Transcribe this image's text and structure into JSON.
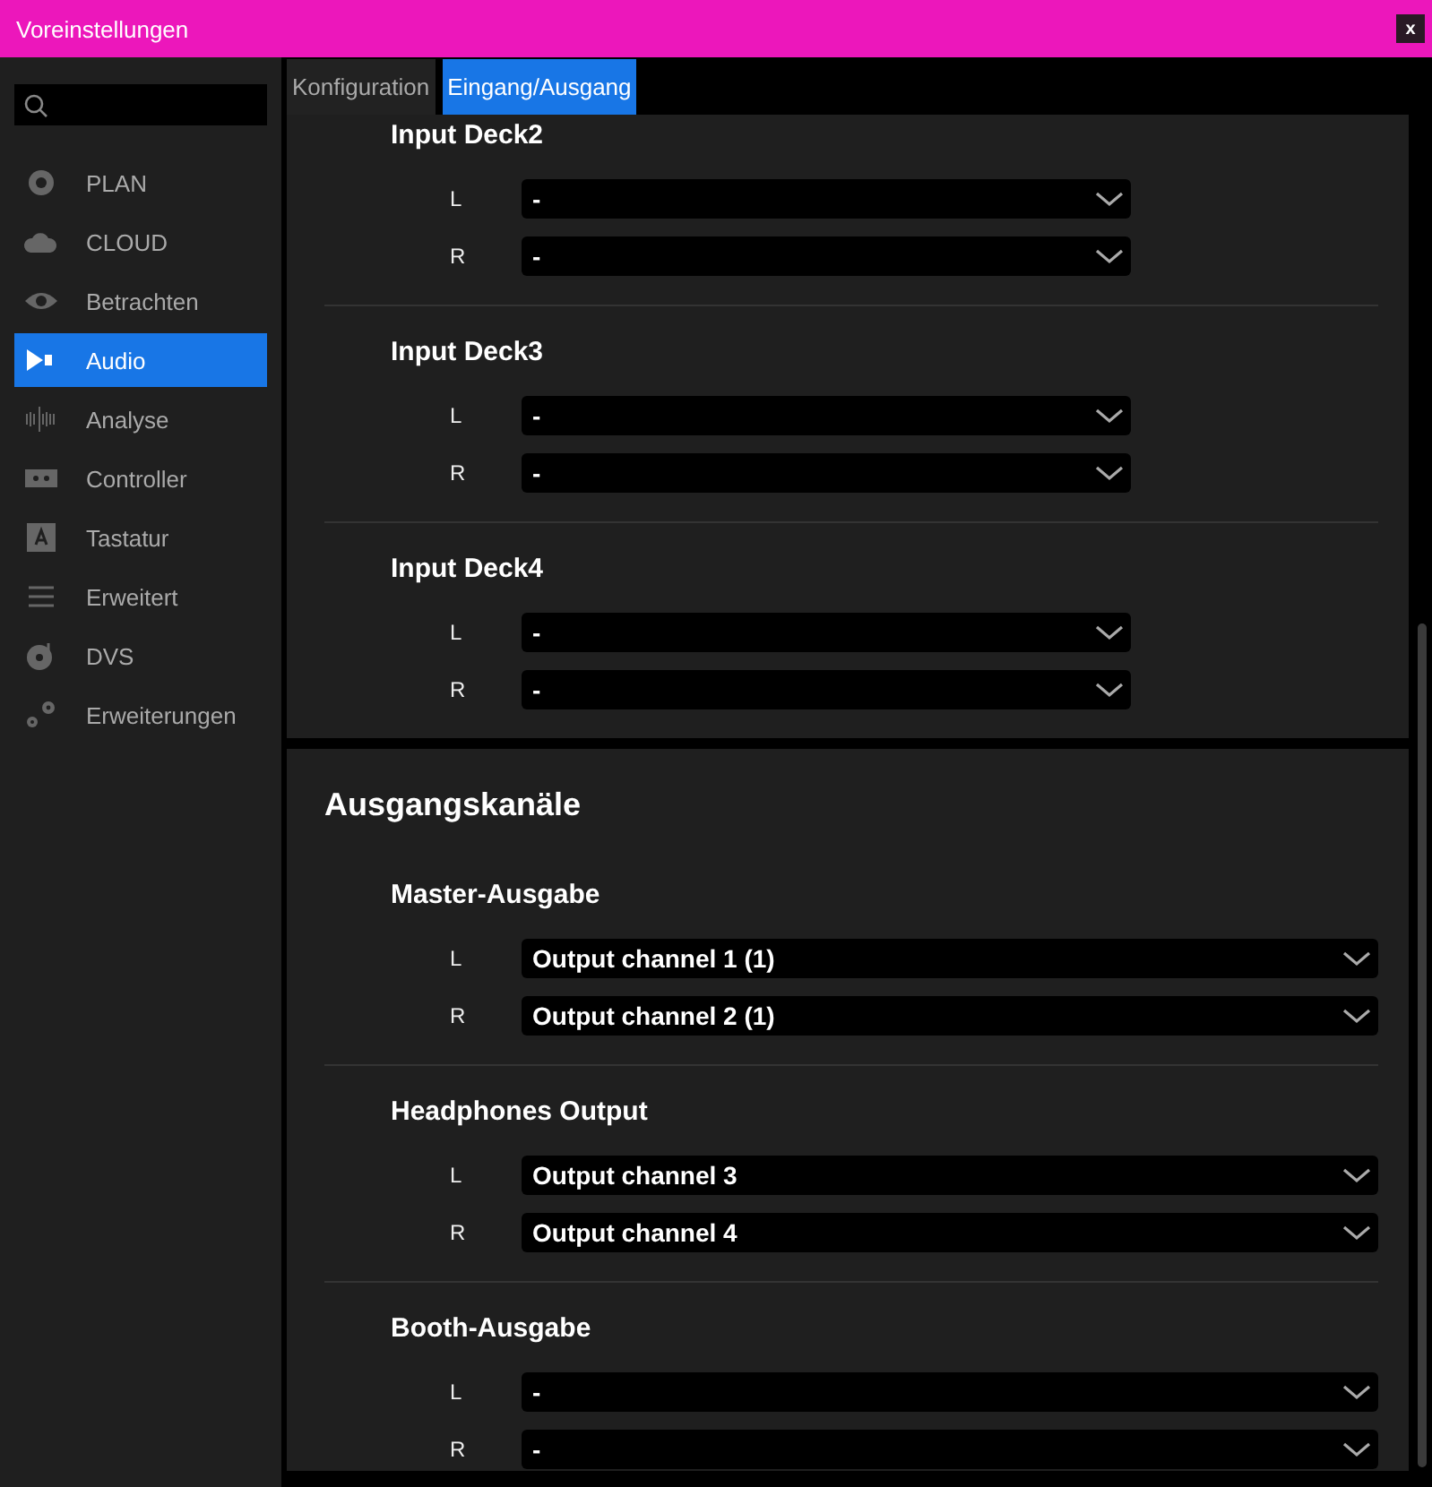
{
  "window": {
    "title": "Voreinstellungen",
    "close": "x"
  },
  "sidebar": {
    "items": [
      {
        "label": "PLAN",
        "selected": false
      },
      {
        "label": "CLOUD",
        "selected": false
      },
      {
        "label": "Betrachten",
        "selected": false
      },
      {
        "label": "Audio",
        "selected": true
      },
      {
        "label": "Analyse",
        "selected": false
      },
      {
        "label": "Controller",
        "selected": false
      },
      {
        "label": "Tastatur",
        "selected": false
      },
      {
        "label": "Erweitert",
        "selected": false
      },
      {
        "label": "DVS",
        "selected": false
      },
      {
        "label": "Erweiterungen",
        "selected": false
      }
    ]
  },
  "tabs": [
    {
      "label": "Konfiguration",
      "selected": false
    },
    {
      "label": "Eingang/Ausgang",
      "selected": true
    }
  ],
  "input_panel": {
    "groups": [
      {
        "heading": "Input Deck2",
        "channels": [
          {
            "label": "L",
            "value": "-"
          },
          {
            "label": "R",
            "value": "-"
          }
        ]
      },
      {
        "heading": "Input Deck3",
        "channels": [
          {
            "label": "L",
            "value": "-"
          },
          {
            "label": "R",
            "value": "-"
          }
        ]
      },
      {
        "heading": "Input Deck4",
        "channels": [
          {
            "label": "L",
            "value": "-"
          },
          {
            "label": "R",
            "value": "-"
          }
        ]
      }
    ]
  },
  "output_panel": {
    "title": "Ausgangskanäle",
    "groups": [
      {
        "heading": "Master-Ausgabe",
        "channels": [
          {
            "label": "L",
            "value": "Output channel 1 (1)"
          },
          {
            "label": "R",
            "value": "Output channel 2 (1)"
          }
        ]
      },
      {
        "heading": "Headphones Output",
        "channels": [
          {
            "label": "L",
            "value": "Output channel 3"
          },
          {
            "label": "R",
            "value": "Output channel 4"
          }
        ]
      },
      {
        "heading": "Booth-Ausgabe",
        "channels": [
          {
            "label": "L",
            "value": "-"
          },
          {
            "label": "R",
            "value": "-"
          }
        ]
      }
    ]
  }
}
